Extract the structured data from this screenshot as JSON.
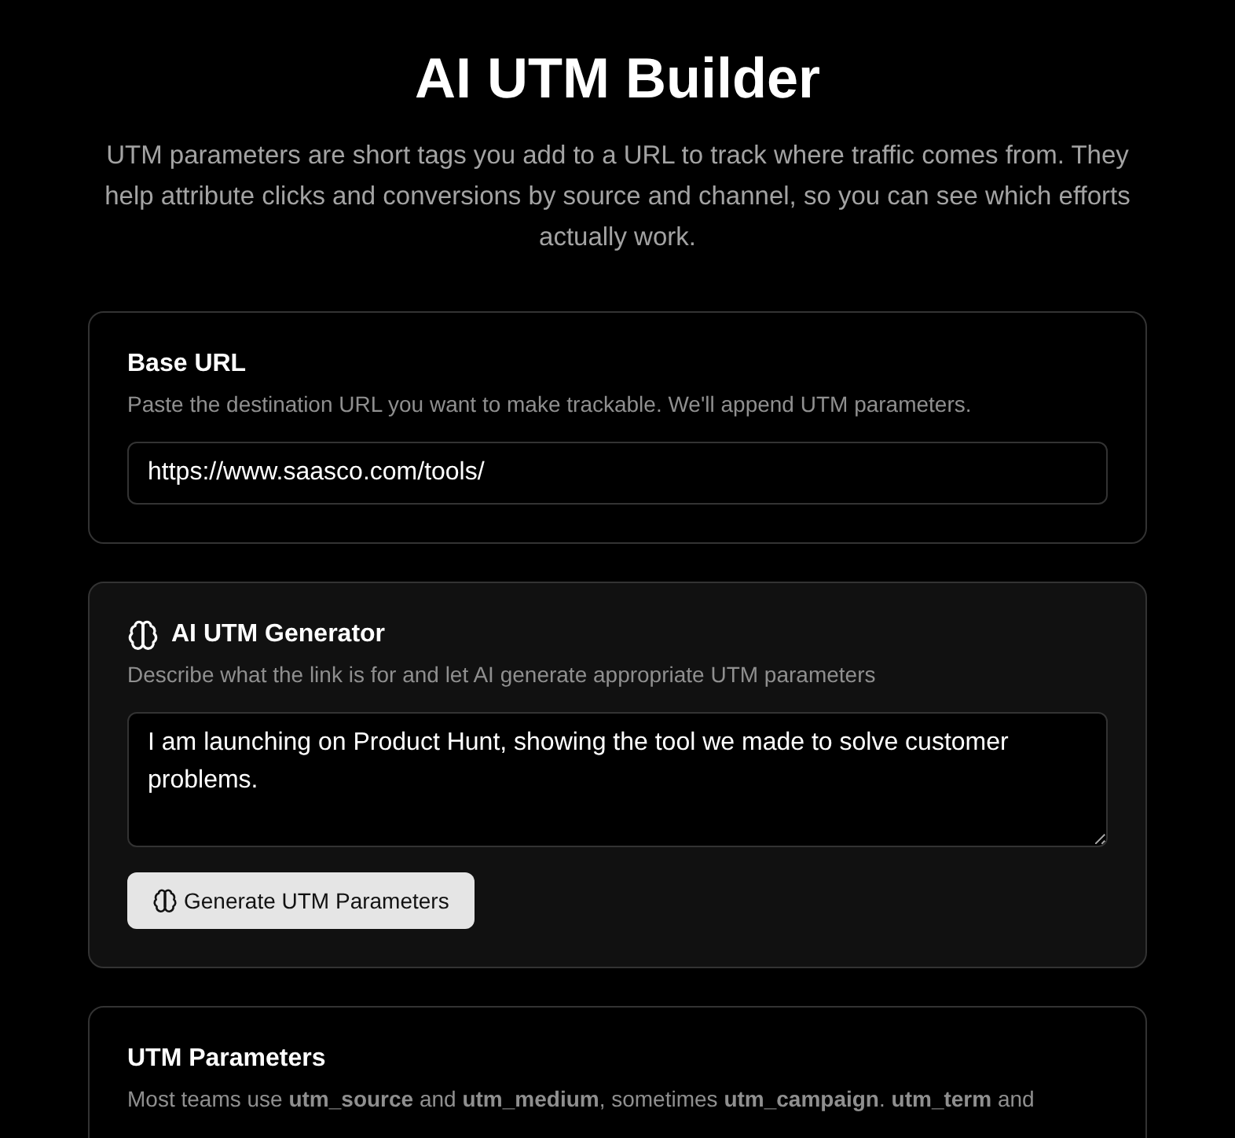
{
  "title": "AI UTM Builder",
  "intro": "UTM parameters are short tags you add to a URL to track where traffic comes from. They help attribute clicks and conversions by source and channel, so you can see which efforts actually work.",
  "base_url": {
    "title": "Base URL",
    "description": "Paste the destination URL you want to make trackable. We'll append UTM parameters.",
    "value": "https://www.saasco.com/tools/"
  },
  "generator": {
    "title": "AI UTM Generator",
    "description": "Describe what the link is for and let AI generate appropriate UTM parameters",
    "value": "I am launching on Product Hunt, showing the tool we made to solve customer problems.",
    "button": "Generate UTM Parameters"
  },
  "parameters": {
    "title": "UTM Parameters",
    "description": "Most teams use **utm_source** and **utm_medium**, sometimes **utm_campaign**.  **utm_term** and"
  }
}
